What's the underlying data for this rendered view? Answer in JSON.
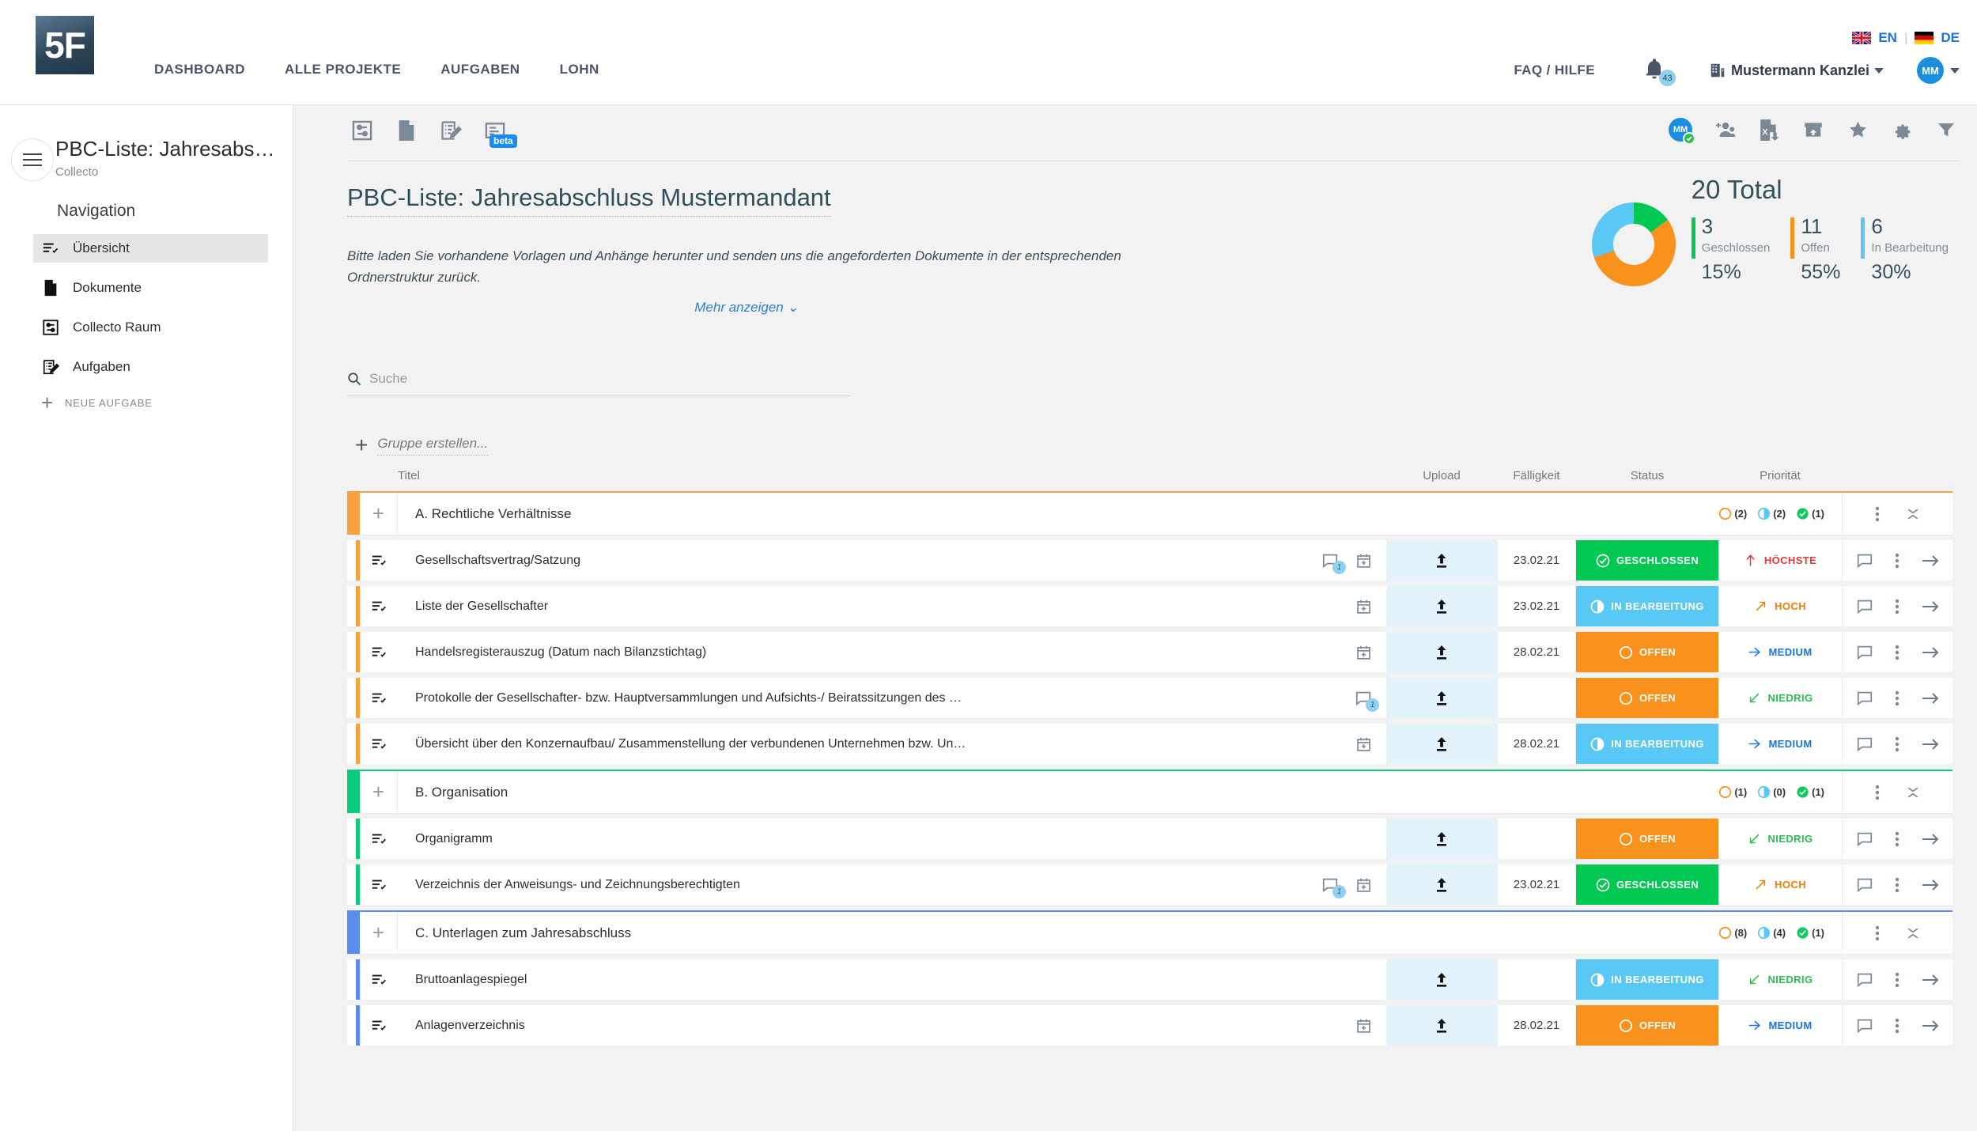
{
  "navbar": {
    "logo_text": "5F",
    "links": [
      {
        "label": "DASHBOARD"
      },
      {
        "label": "ALLE PROJEKTE"
      },
      {
        "label": "AUFGABEN"
      },
      {
        "label": "LOHN"
      }
    ],
    "lang_en": "EN",
    "lang_separator": "|",
    "lang_de": "DE",
    "faq_label": "FAQ / HILFE",
    "notification_count": "43",
    "org_name": "Mustermann Kanzlei",
    "avatar_initials": "MM"
  },
  "sidebar": {
    "title": "PBC-Liste: Jahresabs…",
    "subtitle": "Collecto",
    "nav_label": "Navigation",
    "items": [
      {
        "label": "Übersicht",
        "icon": "list-check-icon",
        "active": true
      },
      {
        "label": "Dokumente",
        "icon": "document-icon",
        "active": false
      },
      {
        "label": "Collecto Raum",
        "icon": "collecto-room-icon",
        "active": false
      },
      {
        "label": "Aufgaben",
        "icon": "task-edit-icon",
        "active": false
      }
    ],
    "new_task_label": "NEUE AUFGABE"
  },
  "toolbar": {
    "left_icons": [
      {
        "name": "collecto-room-icon",
        "badge": ""
      },
      {
        "name": "document-icon",
        "badge": ""
      },
      {
        "name": "task-edit-icon",
        "badge": ""
      },
      {
        "name": "report-icon",
        "badge": "beta"
      }
    ],
    "right_icons": [
      {
        "name": "assigned-user-icon",
        "initials": "MM"
      },
      {
        "name": "add-user-icon"
      },
      {
        "name": "export-excel-icon"
      },
      {
        "name": "archive-upload-icon"
      },
      {
        "name": "favorite-star-icon"
      },
      {
        "name": "settings-gear-icon"
      },
      {
        "name": "filter-icon"
      }
    ]
  },
  "page": {
    "title": "PBC-Liste: Jahresabschluss Mustermandant",
    "description": "Bitte laden Sie vorhandene Vorlagen und Anhänge herunter und senden uns die angeforderten Dokumente in der entsprechenden Ordnerstruktur zurück.",
    "more_link": "Mehr anzeigen"
  },
  "stats": {
    "total_label": "20 Total",
    "items": [
      {
        "count": "3",
        "label": "Geschlossen",
        "percent": "15%",
        "color": "#00c853"
      },
      {
        "count": "11",
        "label": "Offen",
        "percent": "55%",
        "color": "#f8921c"
      },
      {
        "count": "6",
        "label": "In Bearbeitung",
        "percent": "30%",
        "color": "#5ac8f5"
      }
    ]
  },
  "chart_data": {
    "type": "pie",
    "title": "20 Total",
    "categories": [
      "Geschlossen",
      "Offen",
      "In Bearbeitung"
    ],
    "values": [
      3,
      11,
      6
    ],
    "percents": [
      15,
      55,
      30
    ],
    "colors": [
      "#00c853",
      "#f8921c",
      "#5ac8f5"
    ],
    "total": 20,
    "legend": "right"
  },
  "search": {
    "placeholder": "Suche",
    "value": ""
  },
  "create_group": {
    "label": "Gruppe erstellen..."
  },
  "table": {
    "headers": {
      "title": "Titel",
      "upload": "Upload",
      "due": "Fälligkeit",
      "status": "Status",
      "priority": "Priorität"
    },
    "groups": [
      {
        "name": "A. Rechtliche Verhältnisse",
        "color": "#f5a33c",
        "counts": {
          "offen": "(2)",
          "in_bearbeitung": "(2)",
          "geschlossen": "(1)"
        },
        "rows": [
          {
            "title": "Gesellschaftsvertrag/Satzung",
            "comment_badge": "1",
            "has_comment": true,
            "has_calendar": true,
            "due": "23.02.21",
            "status": "GESCHLOSSEN",
            "status_color": "#00c853",
            "status_icon": "check-circle-icon",
            "priority": "HÖCHSTE",
            "priority_color": "#e53935",
            "priority_icon": "arrow-up-icon"
          },
          {
            "title": "Liste der Gesellschafter",
            "comment_badge": "",
            "has_comment": false,
            "has_calendar": true,
            "due": "23.02.21",
            "status": "IN BEARBEITUNG",
            "status_color": "#5ac8f5",
            "status_icon": "half-circle-icon",
            "priority": "HOCH",
            "priority_color": "#f57c00",
            "priority_icon": "arrow-up-right-icon"
          },
          {
            "title": "Handelsregisterauszug (Datum nach Bilanzstichtag)",
            "comment_badge": "",
            "has_comment": false,
            "has_calendar": true,
            "due": "28.02.21",
            "status": "OFFEN",
            "status_color": "#f8921c",
            "status_icon": "empty-circle-icon",
            "priority": "MEDIUM",
            "priority_color": "#1a73e8",
            "priority_icon": "arrow-right-icon"
          },
          {
            "title": "Protokolle der Gesellschafter- bzw. Hauptversammlungen und Aufsichts-/ Beiratssitzungen des …",
            "comment_badge": "1",
            "has_comment": true,
            "has_calendar": false,
            "due": "",
            "status": "OFFEN",
            "status_color": "#f8921c",
            "status_icon": "empty-circle-icon",
            "priority": "NIEDRIG",
            "priority_color": "#2bc04e",
            "priority_icon": "arrow-down-left-icon"
          },
          {
            "title": "Übersicht über den Konzernaufbau/ Zusammenstellung der verbundenen Unternehmen bzw. Un…",
            "comment_badge": "",
            "has_comment": false,
            "has_calendar": true,
            "due": "28.02.21",
            "status": "IN BEARBEITUNG",
            "status_color": "#5ac8f5",
            "status_icon": "half-circle-icon",
            "priority": "MEDIUM",
            "priority_color": "#1a73e8",
            "priority_icon": "arrow-right-icon"
          }
        ]
      },
      {
        "name": "B. Organisation",
        "color": "#0ecb7a",
        "counts": {
          "offen": "(1)",
          "in_bearbeitung": "(0)",
          "geschlossen": "(1)"
        },
        "rows": [
          {
            "title": "Organigramm",
            "comment_badge": "",
            "has_comment": false,
            "has_calendar": false,
            "due": "",
            "status": "OFFEN",
            "status_color": "#f8921c",
            "status_icon": "empty-circle-icon",
            "priority": "NIEDRIG",
            "priority_color": "#2bc04e",
            "priority_icon": "arrow-down-left-icon"
          },
          {
            "title": "Verzeichnis der Anweisungs- und Zeichnungsberechtigten",
            "comment_badge": "1",
            "has_comment": true,
            "has_calendar": true,
            "due": "23.02.21",
            "status": "GESCHLOSSEN",
            "status_color": "#00c853",
            "status_icon": "check-circle-icon",
            "priority": "HOCH",
            "priority_color": "#f57c00",
            "priority_icon": "arrow-up-right-icon"
          }
        ]
      },
      {
        "name": "C. Unterlagen zum Jahresabschluss",
        "color": "#5b8def",
        "counts": {
          "offen": "(8)",
          "in_bearbeitung": "(4)",
          "geschlossen": "(1)"
        },
        "rows": [
          {
            "title": "Bruttoanlagespiegel",
            "comment_badge": "",
            "has_comment": false,
            "has_calendar": false,
            "due": "",
            "status": "IN BEARBEITUNG",
            "status_color": "#5ac8f5",
            "status_icon": "half-circle-icon",
            "priority": "NIEDRIG",
            "priority_color": "#2bc04e",
            "priority_icon": "arrow-down-left-icon"
          },
          {
            "title": "Anlagenverzeichnis",
            "comment_badge": "",
            "has_comment": false,
            "has_calendar": true,
            "due": "28.02.21",
            "status": "OFFEN",
            "status_color": "#f8921c",
            "status_icon": "empty-circle-icon",
            "priority": "MEDIUM",
            "priority_color": "#1a73e8",
            "priority_icon": "arrow-right-icon"
          }
        ]
      }
    ]
  }
}
